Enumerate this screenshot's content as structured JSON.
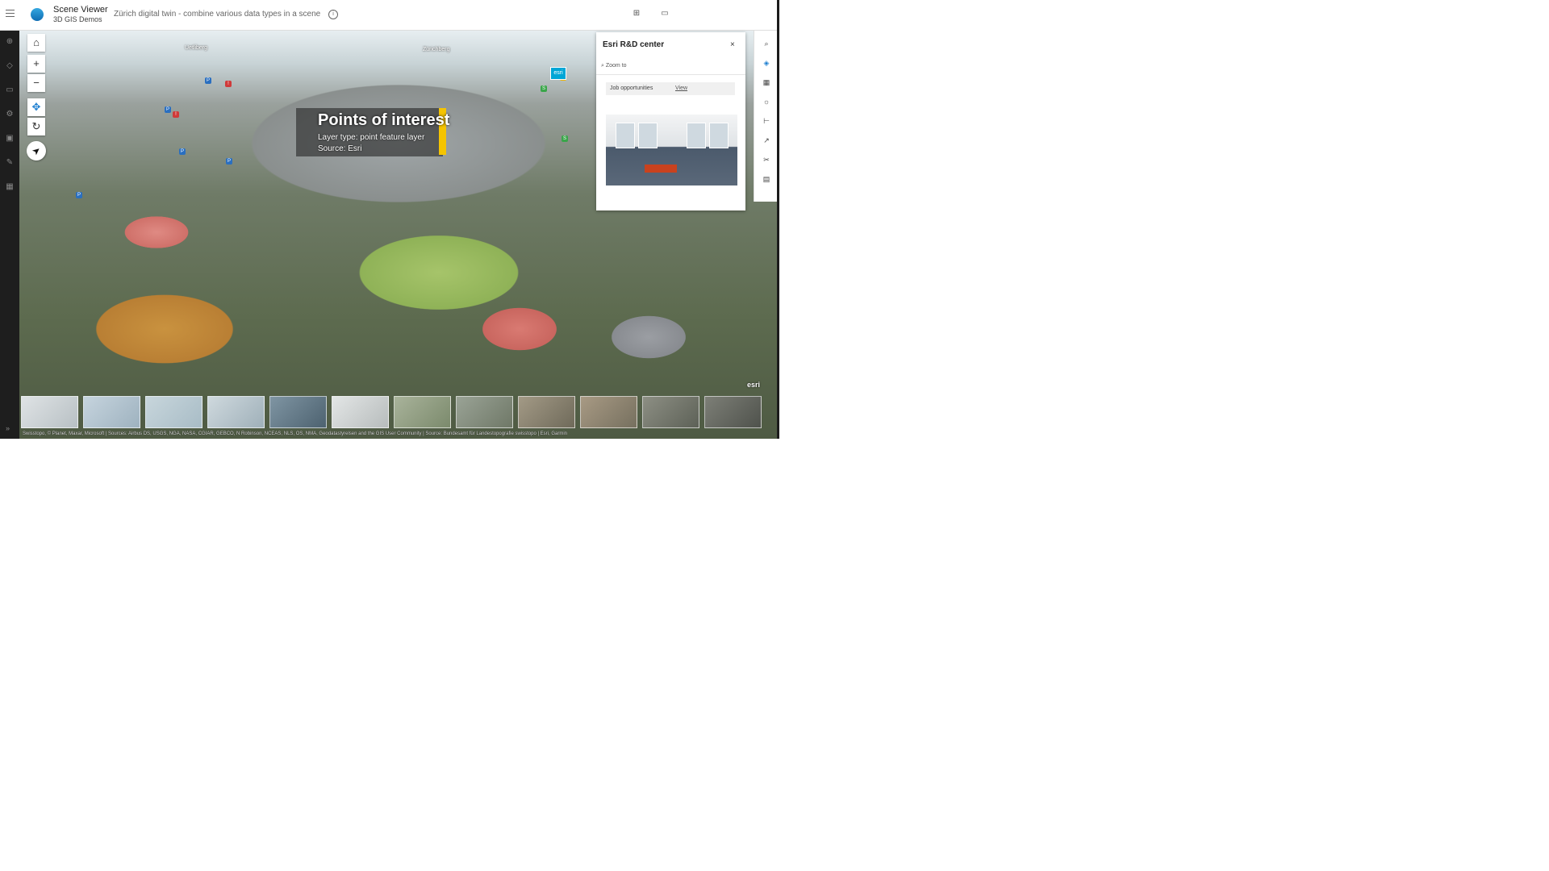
{
  "header": {
    "app_title": "Scene Viewer",
    "app_subtitle": "3D GIS Demos",
    "scene_title": "Zürich digital twin - combine various data types in a scene",
    "info_icon": "info-icon",
    "actions": [
      {
        "icon": "share-icon"
      },
      {
        "icon": "present-icon"
      }
    ]
  },
  "rail": {
    "icons": [
      "add-icon",
      "layers-icon",
      "present-icon",
      "settings-icon",
      "save-icon",
      "edit-icon",
      "apps-icon"
    ]
  },
  "map": {
    "labels": [
      "Uetliberg",
      "Zürichberg"
    ],
    "poi": {
      "title": "Points of interest",
      "line1": "Layer type: point feature layer",
      "line2": "Source: Esri"
    },
    "esri_pin_label": "esri",
    "watermark": "esri",
    "attribution": "Swisstopo, © Planet, Maxar, Microsoft | Sources: Airbus DS, USGS, NGA, NASA, CGIAR, GEBCO, N Robinson, NCEAS, NLS, OS, NMA, Geodatastyrelsen and the GIS User Community | Source: Bundesamt für Landestopografie swisstopo | Esri, Garmin"
  },
  "popup": {
    "title": "Esri R&D center",
    "close": "×",
    "zoom_to": "Zoom to",
    "row_key": "Job opportunities",
    "row_value": "View"
  },
  "tools": [
    "search-icon",
    "layers-icon",
    "basemap-icon",
    "daylight-icon",
    "measure-icon",
    "share-icon",
    "slice-icon",
    "legend-icon"
  ],
  "slides_count": 12,
  "colors": {
    "rail": "#1e1e1e",
    "poi_accent": "#f5c400",
    "esri_pin": "#00a6d6"
  }
}
